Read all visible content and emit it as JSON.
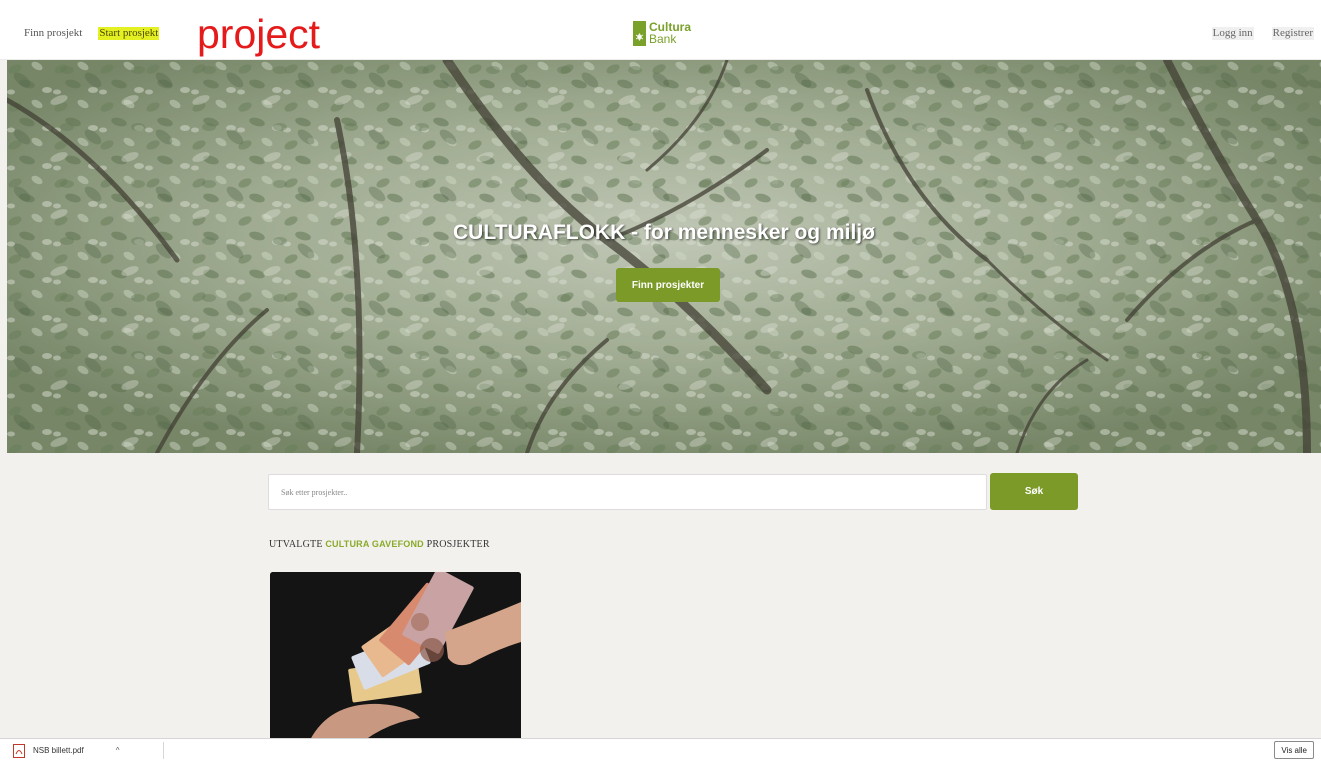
{
  "header": {
    "nav_left": [
      {
        "label": "Finn prosjekt"
      },
      {
        "label": "Start prosjekt"
      }
    ],
    "annotation": "project",
    "logo": {
      "line1": "Cultura",
      "line2": "Bank",
      "color": "#7aa12a"
    },
    "nav_right": [
      {
        "label": "Logg inn"
      },
      {
        "label": "Registrer"
      }
    ]
  },
  "hero": {
    "title": "CULTURAFLOKK - for mennesker og miljø",
    "button_label": "Finn prosjekter"
  },
  "search": {
    "placeholder": "Søk etter prosjekter..",
    "value": "",
    "button_label": "Søk"
  },
  "section": {
    "heading_prefix": "UTVALGTE ",
    "heading_accent": "CULTURA GAVEFOND",
    "heading_suffix": " PROSJEKTER"
  },
  "download_bar": {
    "file_name": "NSB billett.pdf",
    "show_all_label": "Vis alle"
  },
  "colors": {
    "accent": "#7c9a27",
    "highlight": "#e5f023",
    "annotation": "#e51b1b"
  }
}
